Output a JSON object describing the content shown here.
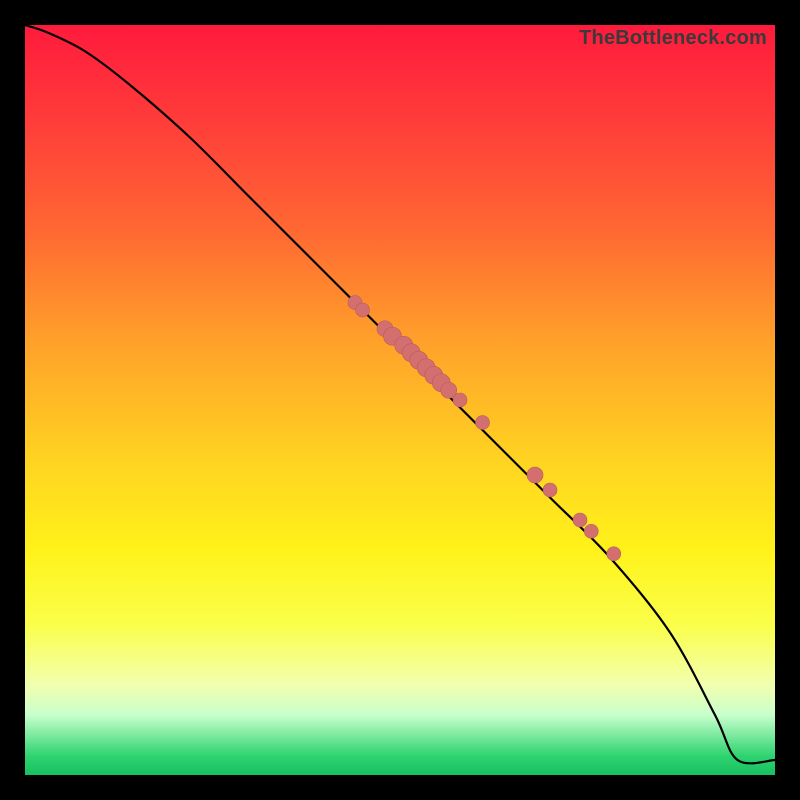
{
  "watermark": "TheBottleneck.com",
  "colors": {
    "frame_bg": "#000000",
    "curve": "#000000",
    "dot_fill": "#d46f6f",
    "dot_stroke": "#b85a5a"
  },
  "chart_data": {
    "type": "line",
    "title": "",
    "xlabel": "",
    "ylabel": "",
    "xlim": [
      0,
      100
    ],
    "ylim": [
      0,
      100
    ],
    "grid": false,
    "legend": false,
    "series": [
      {
        "name": "curve",
        "x": [
          0,
          3,
          8,
          14,
          22,
          30,
          38,
          46,
          54,
          62,
          70,
          78,
          86,
          92,
          95,
          100
        ],
        "y": [
          100,
          99,
          96.5,
          92,
          85,
          77,
          69,
          61,
          53,
          45,
          37,
          29,
          19,
          8,
          2,
          2
        ]
      }
    ],
    "scatter_points": {
      "name": "markers",
      "x": [
        44,
        45,
        48,
        49,
        50.5,
        51.5,
        52.5,
        53.5,
        54.5,
        55.5,
        56.5,
        58,
        61,
        68,
        70,
        74,
        75.5,
        78.5
      ],
      "y": [
        63,
        62,
        59.5,
        58.5,
        57.3,
        56.3,
        55.3,
        54.3,
        53.3,
        52.3,
        51.3,
        50,
        47,
        40,
        38,
        34,
        32.5,
        29.5
      ],
      "r": [
        7,
        7,
        8,
        9,
        9,
        9,
        9,
        9,
        9,
        9,
        8,
        7,
        7,
        8,
        7,
        7,
        7,
        7
      ]
    }
  }
}
